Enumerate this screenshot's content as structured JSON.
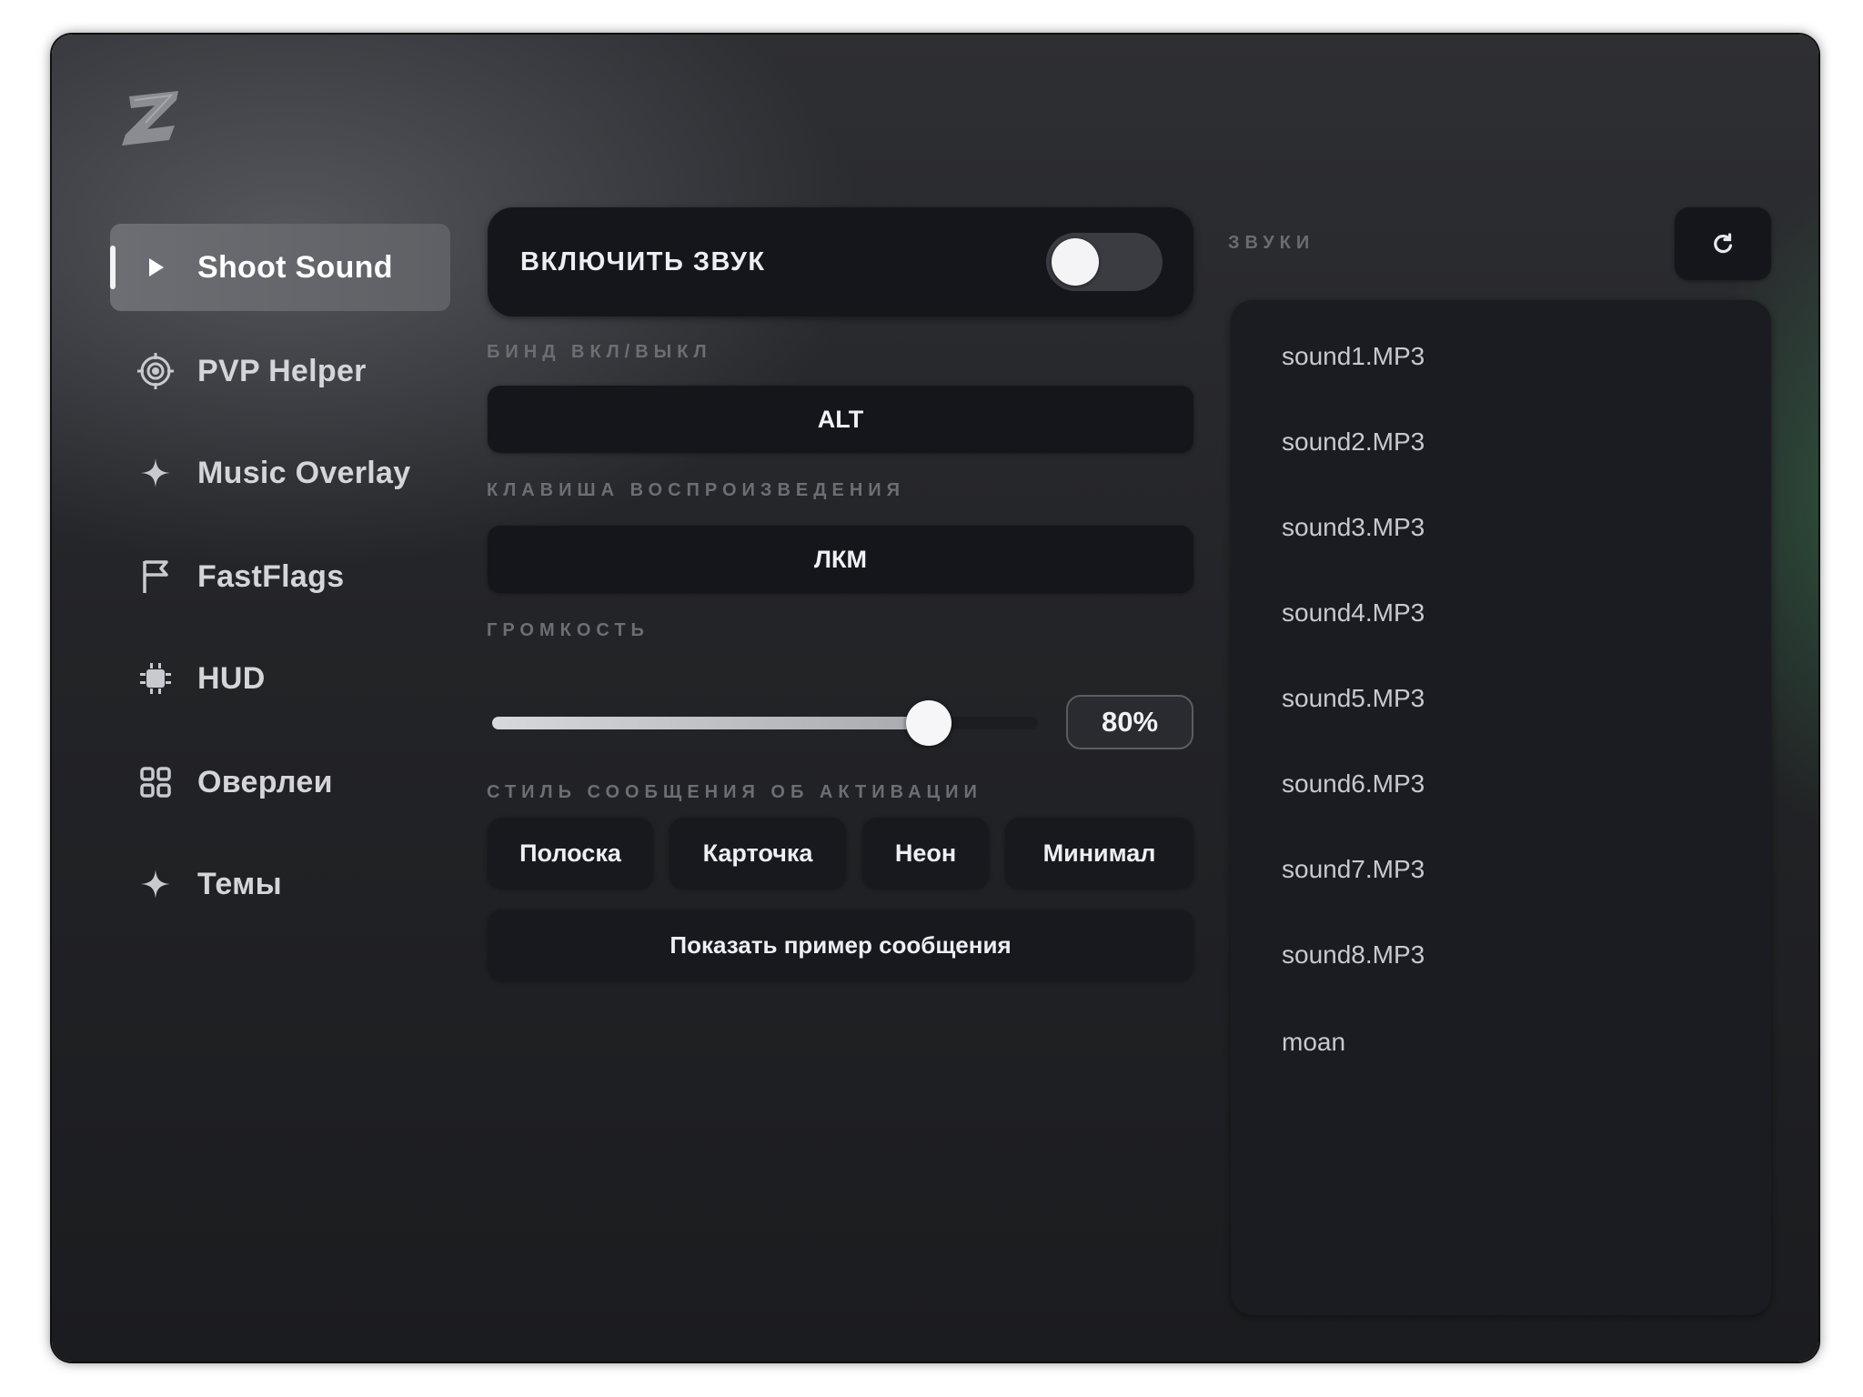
{
  "sidebar": {
    "items": [
      {
        "label": "Shoot Sound",
        "icon": "play-icon",
        "active": true
      },
      {
        "label": "PVP Helper",
        "icon": "crosshair-icon",
        "active": false
      },
      {
        "label": "Music Overlay",
        "icon": "sparkle-icon",
        "active": false
      },
      {
        "label": "FastFlags",
        "icon": "flag-icon",
        "active": false
      },
      {
        "label": "HUD",
        "icon": "chip-icon",
        "active": false
      },
      {
        "label": "Оверлеи",
        "icon": "grid-icon",
        "active": false
      },
      {
        "label": "Темы",
        "icon": "sparkle-icon",
        "active": false
      }
    ]
  },
  "main": {
    "enable_sound": {
      "label": "ВКЛЮЧИТЬ ЗВУК",
      "enabled": false
    },
    "bind_label": "БИНД ВКЛ/ВЫКЛ",
    "bind_value": "ALT",
    "play_key_label": "КЛАВИША ВОСПРОИЗВЕДЕНИЯ",
    "play_key_value": "ЛКМ",
    "volume_label": "ГРОМКОСТЬ",
    "volume_value": "80%",
    "volume_fraction": 0.8,
    "style_label": "СТИЛЬ СООБЩЕНИЯ ОБ АКТИВАЦИИ",
    "styles": [
      "Полоска",
      "Карточка",
      "Неон",
      "Минимал"
    ],
    "preview_button": "Показать пример сообщения"
  },
  "sounds": {
    "label": "ЗВУКИ",
    "refresh_icon": "refresh-icon",
    "items": [
      "sound1.MP3",
      "sound2.MP3",
      "sound3.MP3",
      "sound4.MP3",
      "sound5.MP3",
      "sound6.MP3",
      "sound7.MP3",
      "sound8.MP3",
      "moan"
    ]
  },
  "colors": {
    "background": "#1f2023",
    "card": "#15161b",
    "active_nav": "#65676c",
    "text": "#eceef2",
    "muted_label": "#6c6e74"
  }
}
